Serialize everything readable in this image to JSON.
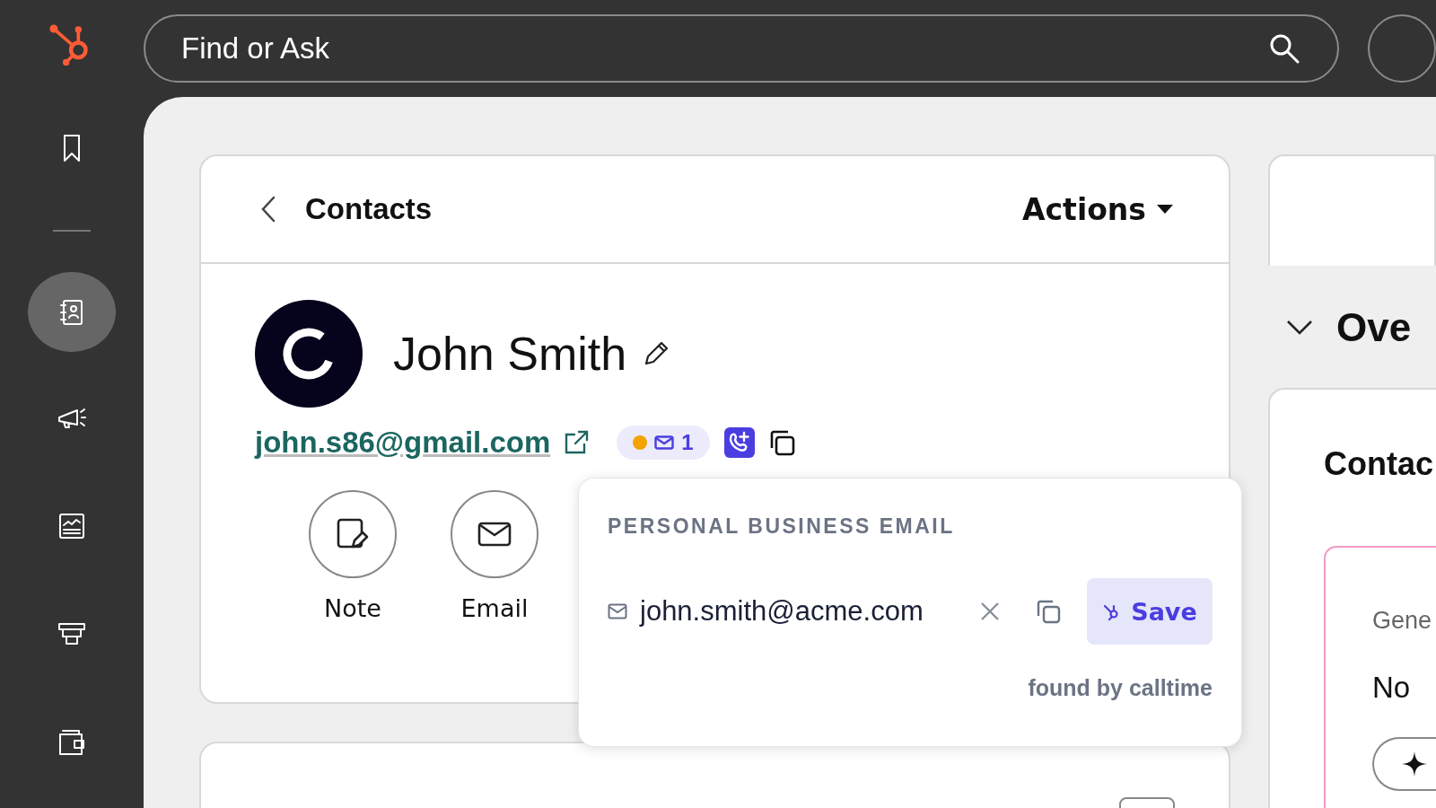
{
  "top_bar": {
    "search": {
      "placeholder": "Find or Ask"
    }
  },
  "sidebar": {
    "items": [
      {
        "kind": "bookmark",
        "selected": false
      },
      {
        "kind": "contacts",
        "selected": true
      },
      {
        "kind": "megaphone",
        "selected": false
      },
      {
        "kind": "report",
        "selected": false
      },
      {
        "kind": "stack",
        "selected": false
      },
      {
        "kind": "wallet",
        "selected": false
      }
    ]
  },
  "record": {
    "back_label": "Contacts",
    "actions": "Actions",
    "name": "John Smith",
    "email": "john.s86@gmail.com",
    "email_badge": {
      "count": "1"
    },
    "quick_actions": [
      {
        "kind": "note",
        "label": "Note"
      },
      {
        "kind": "email",
        "label": "Email"
      }
    ]
  },
  "popover": {
    "heading": "PERSONAL BUSINESS EMAIL",
    "email": "john.smith@acme.com",
    "save": "Save",
    "footer": "found by calltime"
  },
  "right_panel": {
    "section": "Ove",
    "card_title": "Contac",
    "inner_label": "Gene",
    "inner_text": "No"
  }
}
